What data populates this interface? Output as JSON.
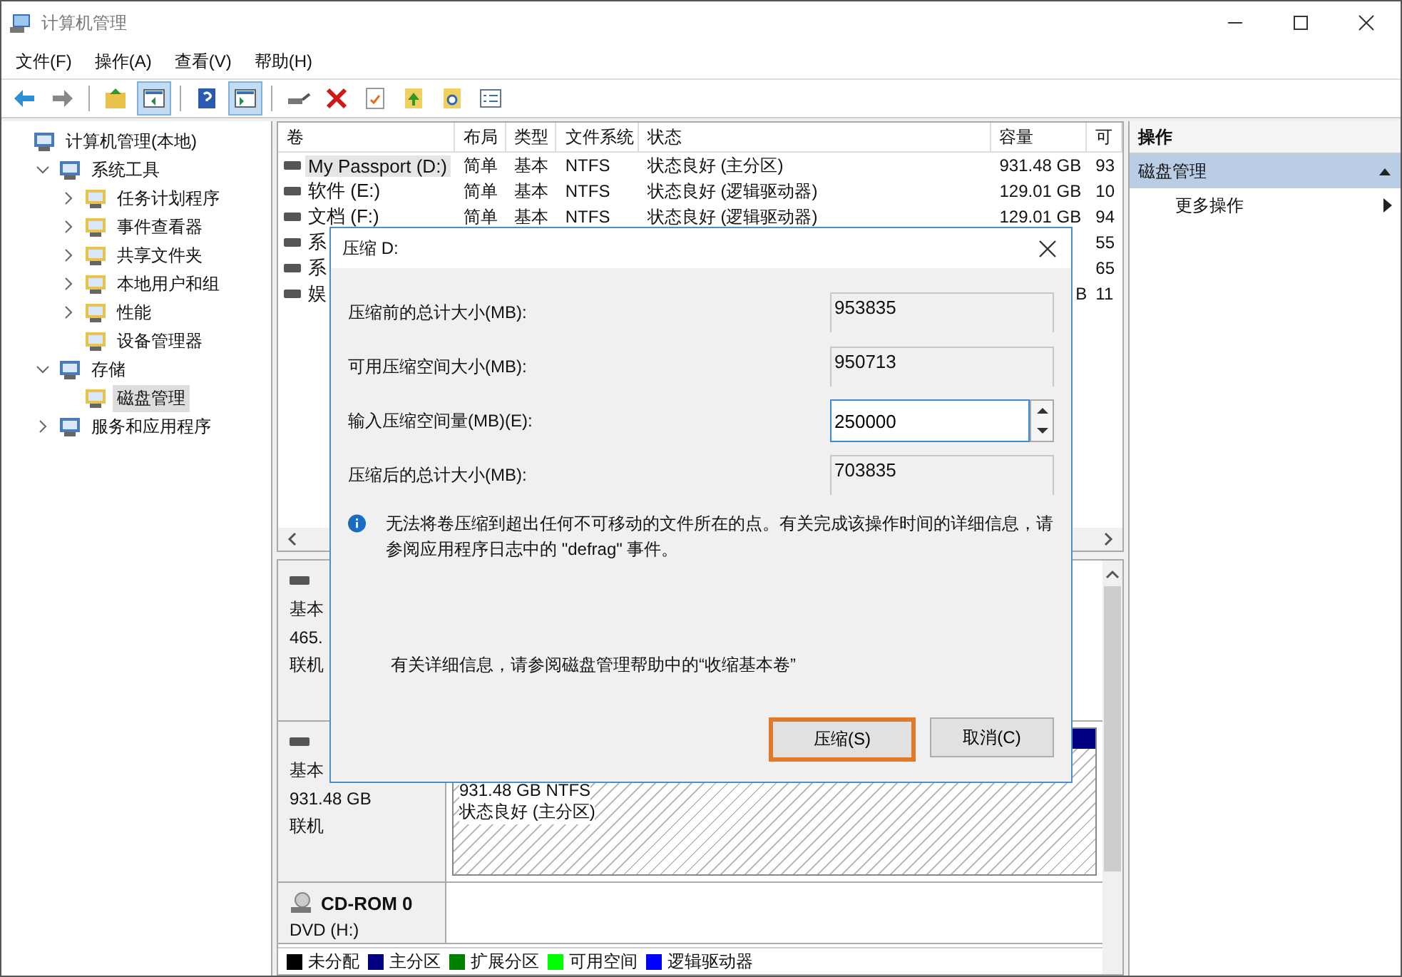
{
  "window": {
    "title": "计算机管理"
  },
  "menu": [
    "文件(F)",
    "操作(A)",
    "查看(V)",
    "帮助(H)"
  ],
  "toolbar": [
    {
      "kind": "back",
      "pressed": false
    },
    {
      "kind": "forward",
      "pressed": false
    },
    {
      "kind": "sep"
    },
    {
      "kind": "up",
      "pressed": false
    },
    {
      "kind": "tree",
      "pressed": true
    },
    {
      "kind": "sep"
    },
    {
      "kind": "help",
      "pressed": false
    },
    {
      "kind": "pane",
      "pressed": true
    },
    {
      "kind": "sep"
    },
    {
      "kind": "connect",
      "pressed": false
    },
    {
      "kind": "delete",
      "pressed": false
    },
    {
      "kind": "check",
      "pressed": false
    },
    {
      "kind": "upfolder",
      "pressed": false
    },
    {
      "kind": "find",
      "pressed": false
    },
    {
      "kind": "list",
      "pressed": false
    }
  ],
  "tree": [
    {
      "label": "计算机管理(本地)",
      "selected": false,
      "children": [
        {
          "label": "系统工具",
          "selected": false,
          "expanded": true,
          "children": [
            {
              "label": "任务计划程序",
              "selected": false,
              "expanded": false
            },
            {
              "label": "事件查看器",
              "selected": false,
              "expanded": false
            },
            {
              "label": "共享文件夹",
              "selected": false,
              "expanded": false
            },
            {
              "label": "本地用户和组",
              "selected": false,
              "expanded": false
            },
            {
              "label": "性能",
              "selected": false,
              "expanded": false
            },
            {
              "label": "设备管理器",
              "selected": false
            }
          ]
        },
        {
          "label": "存储",
          "selected": false,
          "expanded": true,
          "children": [
            {
              "label": "磁盘管理",
              "selected": true
            }
          ]
        },
        {
          "label": "服务和应用程序",
          "selected": false,
          "expanded": false
        }
      ]
    }
  ],
  "table": {
    "columns": [
      "卷",
      "布局",
      "类型",
      "文件系统",
      "状态",
      "容量",
      "可"
    ],
    "rows": [
      {
        "selected": true,
        "cells": [
          "My Passport (D:)",
          "简单",
          "基本",
          "NTFS",
          "状态良好 (主分区)",
          "931.48 GB",
          "93"
        ]
      },
      {
        "selected": false,
        "cells": [
          "软件 (E:)",
          "简单",
          "基本",
          "NTFS",
          "状态良好 (逻辑驱动器)",
          "129.01 GB",
          "10"
        ]
      },
      {
        "selected": false,
        "cells": [
          "文档 (F:)",
          "简单",
          "基本",
          "NTFS",
          "状态良好 (逻辑驱动器)",
          "129.01 GB",
          "94"
        ]
      },
      {
        "selected": false,
        "cells": [
          "系",
          null,
          null,
          null,
          null,
          null,
          "55"
        ]
      },
      {
        "selected": false,
        "cells": [
          "系",
          null,
          null,
          null,
          null,
          null,
          "65"
        ]
      },
      {
        "selected": false,
        "cells": [
          "娱",
          null,
          null,
          null,
          null,
          "B",
          "11"
        ]
      }
    ]
  },
  "disks": [
    {
      "kind": "disk",
      "lines": [
        "基本",
        "465.",
        "联机"
      ]
    },
    {
      "kind": "disk",
      "lines": [
        "基本",
        "931.48 GB",
        "联机"
      ],
      "partition": {
        "lines": [
          "931.48 GB NTFS",
          "状态良好 (主分区)"
        ],
        "color": "#000080"
      }
    },
    {
      "kind": "cdrom",
      "name": "CD-ROM 0",
      "lines": [
        "DVD (H:)"
      ]
    }
  ],
  "legend": [
    {
      "label": "未分配",
      "color": "#000000"
    },
    {
      "label": "主分区",
      "color": "#000080"
    },
    {
      "label": "扩展分区",
      "color": "#008000"
    },
    {
      "label": "可用空间",
      "color": "#00ff00"
    },
    {
      "label": "逻辑驱动器",
      "color": "#0000ff"
    }
  ],
  "actions": {
    "header": "操作",
    "section": {
      "label": "磁盘管理",
      "expanded": true
    },
    "items": [
      "更多操作"
    ]
  },
  "dialog": {
    "title": "压缩 D:",
    "fields": [
      {
        "label": "压缩前的总计大小(MB):",
        "value": "953835",
        "kind": "readonly"
      },
      {
        "label": "可用压缩空间大小(MB):",
        "value": "950713",
        "kind": "readonly"
      },
      {
        "label": "输入压缩空间量(MB)(E):",
        "value": "250000",
        "kind": "spin"
      },
      {
        "label": "压缩后的总计大小(MB):",
        "value": "703835",
        "kind": "readonly"
      }
    ],
    "info": "无法将卷压缩到超出任何不可移动的文件所在的点。有关完成该操作时间的详细信息，请参阅应用程序日志中的 \"defrag\" 事件。",
    "help": "有关详细信息，请参阅磁盘管理帮助中的“收缩基本卷”",
    "buttons": [
      {
        "label": "压缩(S)",
        "default": true
      },
      {
        "label": "取消(C)",
        "default": false
      }
    ]
  }
}
